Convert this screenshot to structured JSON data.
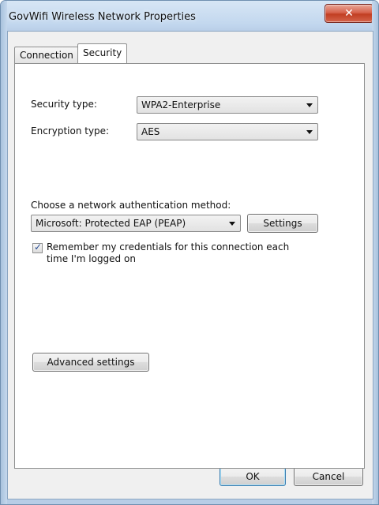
{
  "window": {
    "title": "GovWifi Wireless Network Properties",
    "close_glyph": "✕"
  },
  "tabs": [
    {
      "label": "Connection",
      "active": false
    },
    {
      "label": "Security",
      "active": true
    }
  ],
  "security": {
    "security_type_label": "Security type:",
    "security_type_value": "WPA2-Enterprise",
    "encryption_type_label": "Encryption type:",
    "encryption_type_value": "AES",
    "auth_method_label": "Choose a network authentication method:",
    "auth_method_value": "Microsoft: Protected EAP (PEAP)",
    "settings_button": "Settings",
    "remember_label_line1": "Remember my credentials for this connection each",
    "remember_label_line2": "time I'm logged on",
    "remember_checked": true,
    "advanced_button": "Advanced settings"
  },
  "footer": {
    "ok_button": "OK",
    "cancel_button": "Cancel"
  },
  "icons": {
    "close": "close-icon",
    "dropdown": "chevron-down-icon",
    "check": "checkmark-icon"
  },
  "colors": {
    "titlebar": "#c2d7ee",
    "close_button": "#c13e22",
    "panel": "#ffffff",
    "dialog_bg": "#f0f0f0"
  }
}
